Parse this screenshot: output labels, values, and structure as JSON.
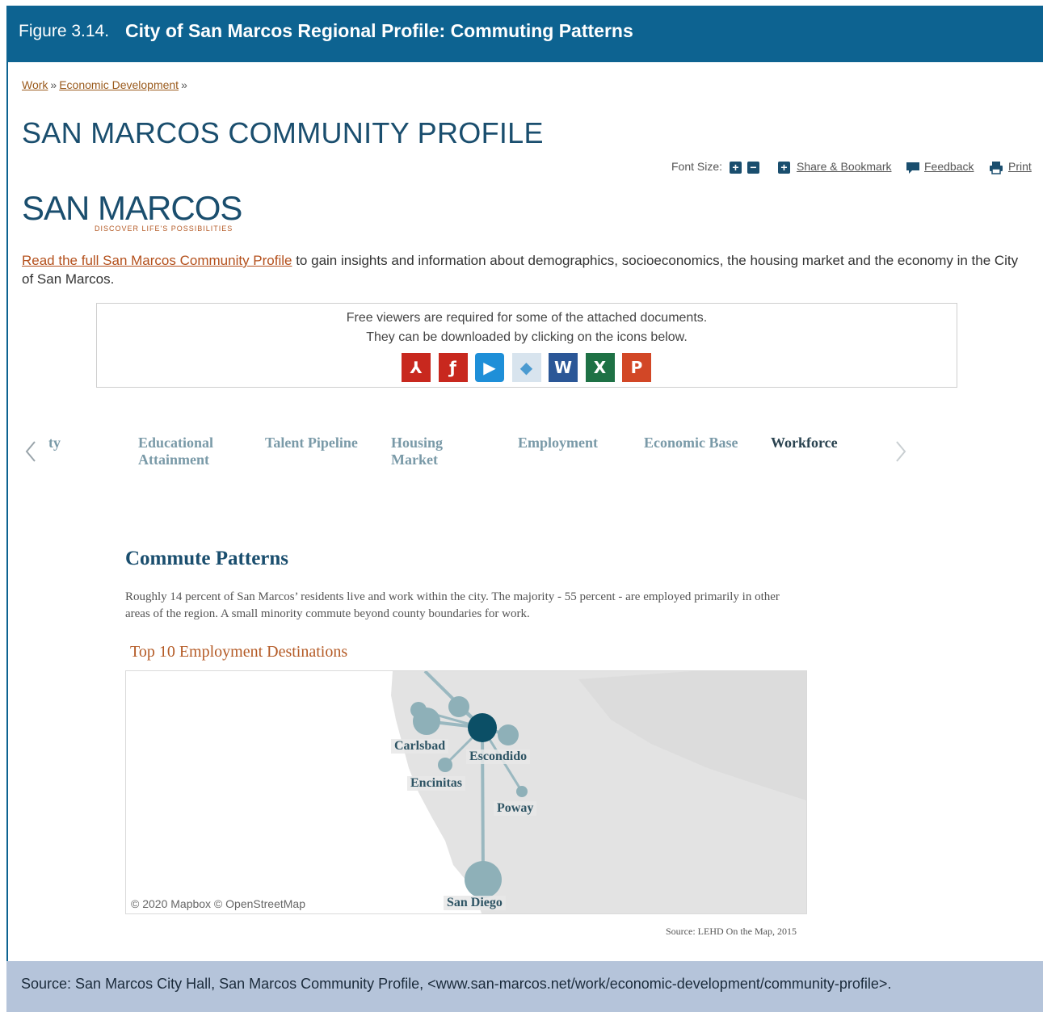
{
  "figure": {
    "number": "Figure 3.14.",
    "title": "City of San Marcos Regional Profile: Commuting Patterns",
    "source": "Source: San Marcos City Hall, San Marcos Community Profile, <www.san-marcos.net/work/economic-development/community-profile>."
  },
  "breadcrumb": {
    "items": [
      "Work",
      "Economic Development"
    ],
    "separator": "»"
  },
  "page": {
    "title": "SAN MARCOS COMMUNITY PROFILE"
  },
  "toolbar": {
    "font_size_label": "Font Size:",
    "plus": "+",
    "minus": "−",
    "share_label": "Share & Bookmark",
    "feedback_label": "Feedback",
    "print_label": "Print"
  },
  "logo": {
    "wordmark": "SAN MARCOS",
    "tagline": "DISCOVER LIFE'S POSSIBILITIES"
  },
  "intro": {
    "link_text": "Read the full San Marcos Community Profile",
    "rest": " to gain insights and information about demographics, socioeconomics, the housing market and the economy in the City of San Marcos."
  },
  "viewers": {
    "line1": "Free viewers are required for some of the attached documents.",
    "line2": "They can be downloaded by clicking on the icons below.",
    "icons": [
      {
        "name": "pdf-icon",
        "bg": "#c8281e",
        "glyph": "⅄"
      },
      {
        "name": "flash-icon",
        "bg": "#c8281e",
        "glyph": "ƒ"
      },
      {
        "name": "media-player-icon",
        "bg": "#1e8fd8",
        "glyph": "▶"
      },
      {
        "name": "viewer-icon",
        "bg": "#d8e4ee",
        "glyph": "◆"
      },
      {
        "name": "word-icon",
        "bg": "#2b5797",
        "glyph": "W"
      },
      {
        "name": "excel-icon",
        "bg": "#1e7145",
        "glyph": "X"
      },
      {
        "name": "powerpoint-icon",
        "bg": "#d24726",
        "glyph": "P"
      }
    ]
  },
  "tabs": {
    "partial": "ty",
    "items": [
      {
        "line1": "Educational",
        "line2": "Attainment"
      },
      {
        "line1": "Talent Pipeline",
        "line2": ""
      },
      {
        "line1": "Housing",
        "line2": "Market"
      },
      {
        "line1": "Employment",
        "line2": ""
      },
      {
        "line1": "Economic Base",
        "line2": ""
      },
      {
        "line1": "Workforce",
        "line2": ""
      }
    ],
    "active": "Workforce"
  },
  "commute": {
    "title": "Commute Patterns",
    "body": "Roughly 14 percent of San Marcos’ residents live and work within the city. The  majority - 55 percent - are employed primarily in other areas of the region. A small minority commute beyond county boundaries for work.",
    "destinations_title": "Top 10 Employment Destinations"
  },
  "map": {
    "labels": [
      "Carlsbad",
      "Escondido",
      "Encinitas",
      "Poway",
      "San Diego"
    ],
    "credit": "© 2020 Mapbox © OpenStreetMap",
    "source": "Source: LEHD On the Map, 2015",
    "colors": {
      "origin": "#0b4f66",
      "destination": "#8eb0b8",
      "land": "#e4e4e4"
    }
  }
}
